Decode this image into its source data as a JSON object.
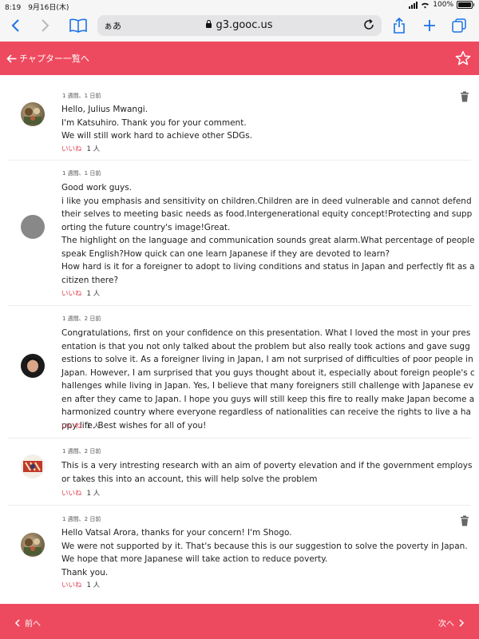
{
  "status": {
    "time_date": "8:19　9月16日(木)",
    "battery": "100%"
  },
  "browser": {
    "aa_label": "ぁあ",
    "domain": "g3.gooc.us"
  },
  "header": {
    "back_label": "チャプター一覧へ"
  },
  "comments": [
    {
      "meta": "1 週間、1 日前",
      "text": "Hello, Julius Mwangi.\nI'm Katsuhiro. Thank you for your comment.\nWe will still work hard to achieve other SDGs.",
      "like_label": "いいね",
      "like_count": "1 人"
    },
    {
      "meta": "1 週間、1 日前",
      "text": "Good work guys.\ni like you emphasis and sensitivity on children.Children are in deed vulnerable and cannot defend their selves to meeting basic needs as food.Intergenerational equity concept!Protecting and supporting the future country's image!Great.\nThe highlight on the language and communication sounds great alarm.What percentage of people speak English?How quick can one learn Japanese if they are devoted to learn?\nHow hard is it for a foreigner to adopt to living conditions and status in Japan and perfectly fit as a citizen there?",
      "like_label": "いいね",
      "like_count": "1 人"
    },
    {
      "meta": "1 週間、2 日前",
      "text": "Congratulations, first on your confidence on this presentation. What I loved the most in your presentation is that you not only talked about the problem but also really took actions and gave suggestions to solve it. As a foreigner living in Japan, I am not surprised of difficulties of poor people in Japan. However, I am surprised that you guys thought about it, especially about foreign people's challenges while living in Japan. Yes, I believe that many foreigners still challenge with Japanese even after they came to Japan. I hope you guys will still keep this fire to really make Japan become a harmonized country where everyone regardless of nationalities can receive the rights to live a happy life. Best wishes for all of you!",
      "like_label": "いいね",
      "like_count": "1 人"
    },
    {
      "meta": "1 週間、2 日前",
      "text": "This is a very intresting research with an aim of poverty elevation and if the government employs or takes this into an account, this will help solve the problem",
      "like_label": "いいね",
      "like_count": "1 人"
    },
    {
      "meta": "1 週間、2 日前",
      "text": "Hello Vatsal Arora, thanks for your concern! I'm Shogo.\nWe were not supported by it. That's because this is our suggestion to solve the poverty in Japan. We hope that more Japanese will take action to reduce poverty.\nThank you.",
      "like_label": "いいね",
      "like_count": "1 人"
    }
  ],
  "footer": {
    "prev_label": "前へ",
    "next_label": "次へ"
  },
  "colors": {
    "accent": "#ee4a5f",
    "link": "#1a73e8",
    "like": "#e0404f"
  }
}
